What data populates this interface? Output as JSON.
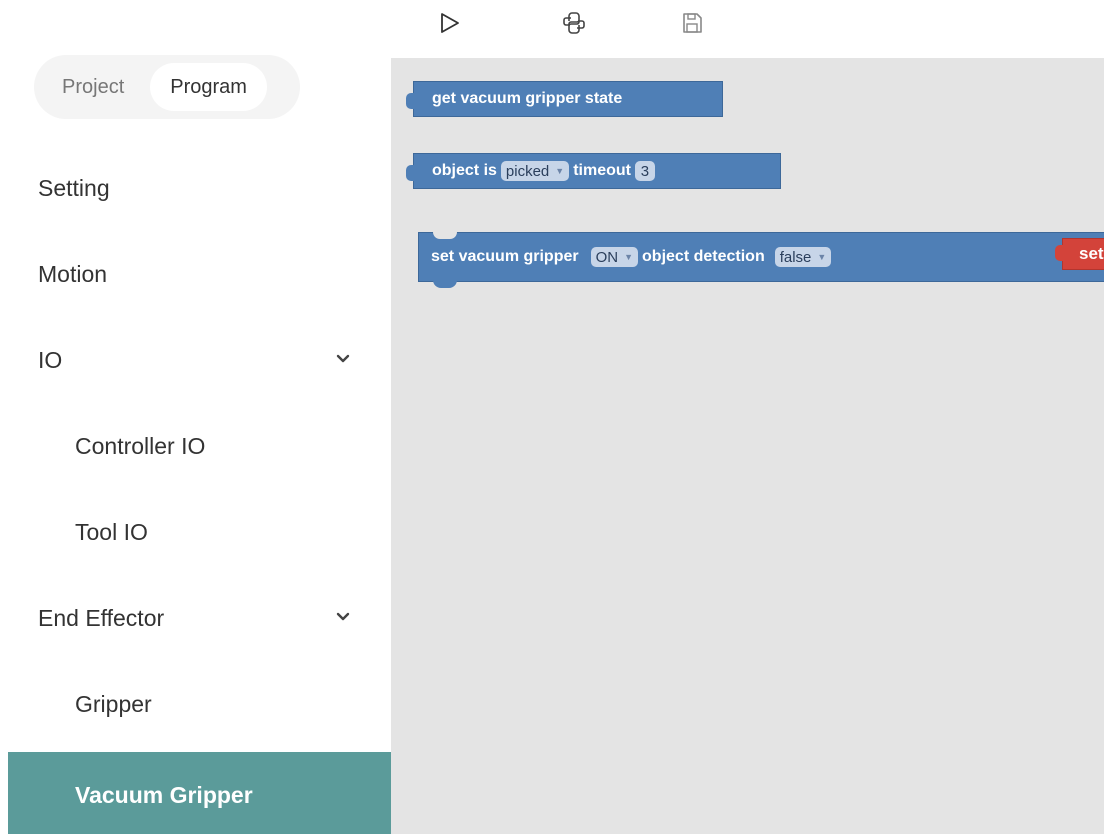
{
  "toolbar": {
    "run_icon": "play-icon",
    "code_icon": "python-icon",
    "save_icon": "save-icon"
  },
  "sidebar": {
    "tabs": [
      {
        "label": "Project",
        "active": false
      },
      {
        "label": "Program",
        "active": true
      }
    ],
    "menu": {
      "setting": "Setting",
      "motion": "Motion",
      "io": "IO",
      "controller_io": "Controller IO",
      "tool_io": "Tool IO",
      "end_effector": "End Effector",
      "gripper": "Gripper",
      "vacuum_gripper": "Vacuum Gripper"
    },
    "active_item": "Vacuum Gripper",
    "active_color": "#5b9b9a"
  },
  "workspace": {
    "blocks": {
      "get_state": "get vacuum gripper state",
      "object_is": {
        "prefix": "object is",
        "state": "picked",
        "timeout_label": "timeout",
        "timeout_value": "3"
      },
      "set_gripper": {
        "prefix": "set vacuum gripper",
        "mode": "ON",
        "detection_label": "object detection",
        "detection_value": "false",
        "set_label": "set"
      }
    },
    "block_color": "#4f7fb6",
    "action_color": "#d3433a"
  }
}
